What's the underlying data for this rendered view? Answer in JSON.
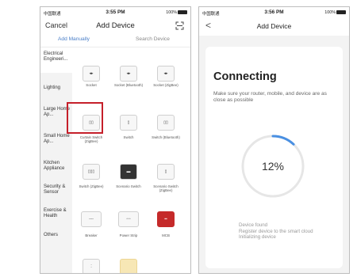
{
  "left_screen": {
    "status": {
      "carrier": "中国联通",
      "time": "3:55 PM",
      "battery": "100%"
    },
    "nav": {
      "cancel": "Cancel",
      "title": "Add Device"
    },
    "tabs": {
      "manual": "Add Manually",
      "search": "Search Device"
    },
    "sidebar": [
      "Electrical Engineeri...",
      "Lighting",
      "Large Home Ap...",
      "Small Home Ap...",
      "Kitchen Appliance",
      "Security & Sensor",
      "Exercise & Health",
      "Others"
    ],
    "devices": [
      {
        "label": "Socket",
        "icon": "socket-icon"
      },
      {
        "label": "Socket (Bluetooth)",
        "icon": "socket-icon"
      },
      {
        "label": "Socket (ZigBee)",
        "icon": "socket-icon"
      },
      {
        "label": "",
        "icon": "switch-icon"
      },
      {
        "label": "",
        "icon": "switch-icon"
      },
      {
        "label": "",
        "icon": "switch-icon"
      },
      {
        "label": "Curtain Switch (ZigBee)",
        "icon": "curtain-switch-icon"
      },
      {
        "label": "Switch",
        "icon": "switch-icon"
      },
      {
        "label": "Switch (Bluetooth)",
        "icon": "switch-icon"
      },
      {
        "label": "",
        "icon": "switch-icon"
      },
      {
        "label": "",
        "icon": "scene-switch-icon"
      },
      {
        "label": "",
        "icon": "switch-icon"
      },
      {
        "label": "Switch (ZigBee)",
        "icon": "switch-icon"
      },
      {
        "label": "Scenario Switch",
        "icon": "scene-switch-icon"
      },
      {
        "label": "Scenario Switch (ZigBee)",
        "icon": "scene-switch-icon"
      },
      {
        "label": "",
        "icon": "breaker-icon"
      },
      {
        "label": "",
        "icon": "power-strip-icon"
      },
      {
        "label": "",
        "icon": "mcb-icon"
      },
      {
        "label": "Breaker",
        "icon": "breaker-icon"
      },
      {
        "label": "Power Strip",
        "icon": "power-strip-icon"
      },
      {
        "label": "MCB",
        "icon": "mcb-icon"
      },
      {
        "label": "",
        "icon": "socket-icon"
      },
      {
        "label": "",
        "icon": "lamp-icon"
      }
    ],
    "selected_device": "Socket"
  },
  "right_screen": {
    "status": {
      "carrier": "中国联通",
      "time": "3:56 PM",
      "battery": "100%"
    },
    "nav": {
      "back": "<",
      "title": "Add Device"
    },
    "title": "Connecting",
    "description": "Make sure your router, mobile, and device are as close as possible",
    "progress_percent": 12,
    "progress_label": "12%",
    "steps": [
      "Device found",
      "Register device to the smart cloud",
      "Initializing device"
    ],
    "colors": {
      "progress": "#4a90e2",
      "ring_bg": "#e6e6e6"
    }
  }
}
